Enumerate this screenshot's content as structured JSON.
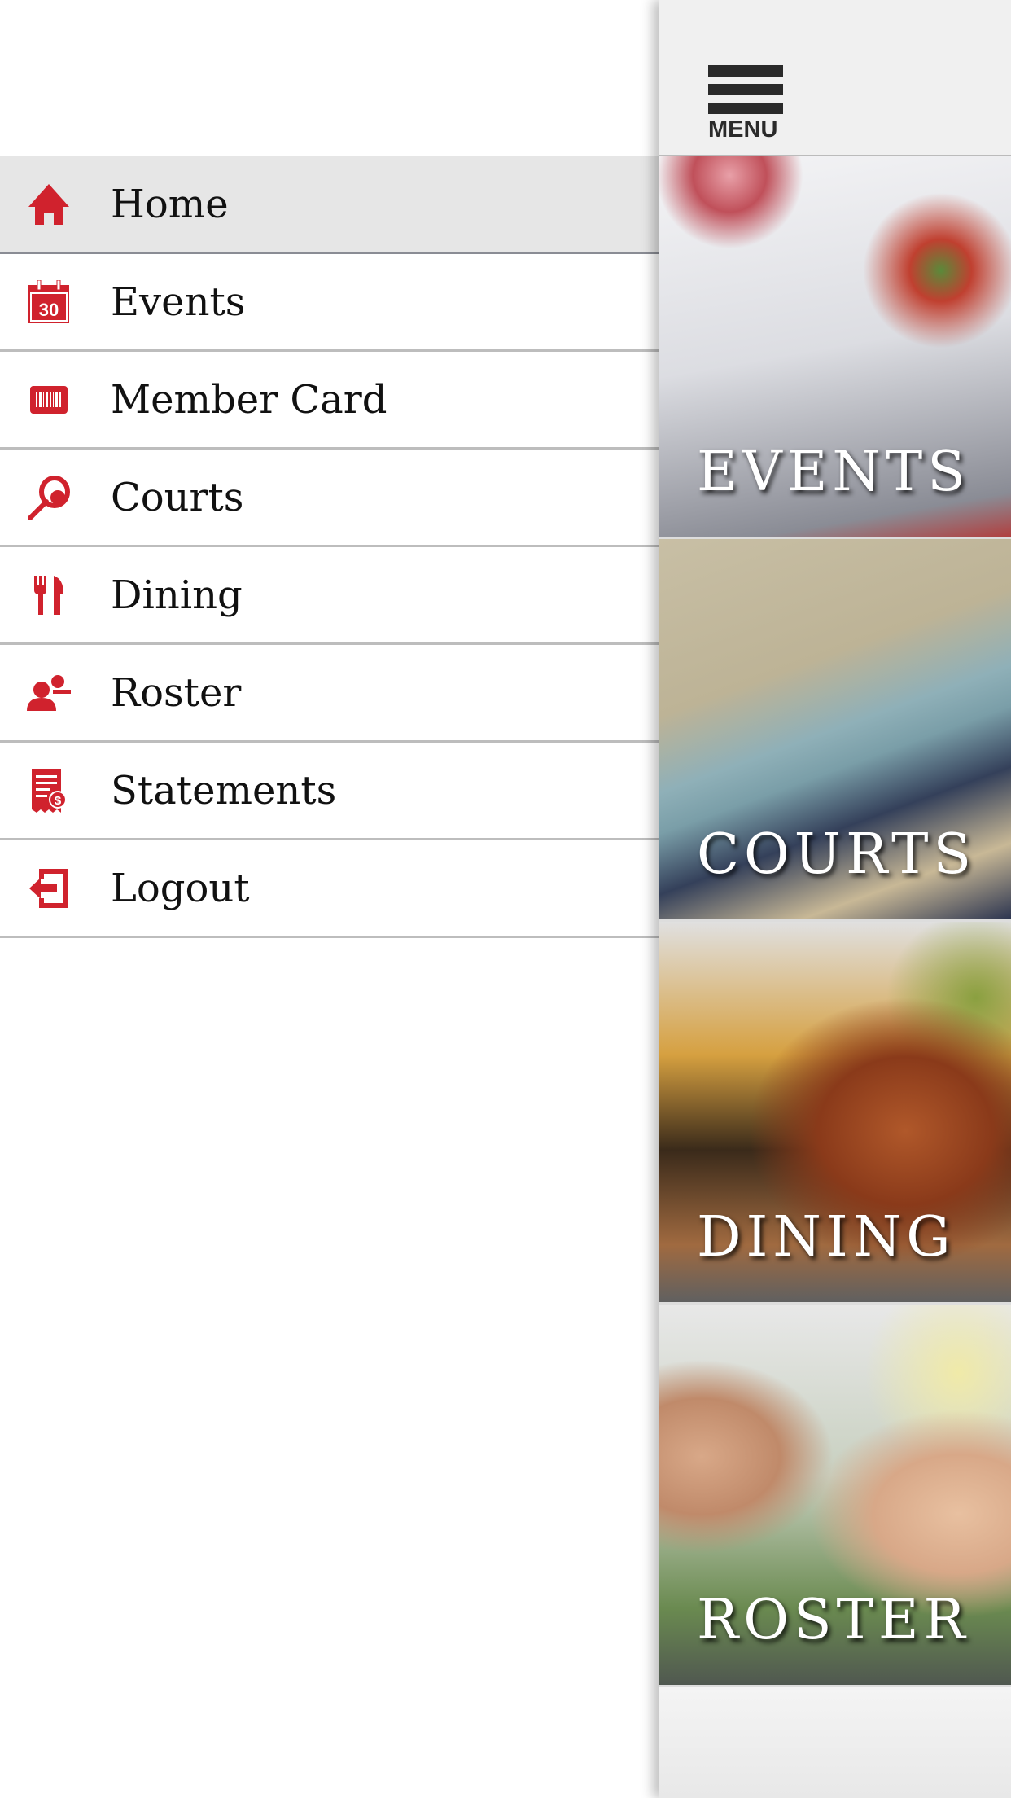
{
  "drawer": {
    "accent": "#d0222d",
    "items": [
      {
        "label": "Home",
        "icon": "home-icon",
        "active": true
      },
      {
        "label": "Events",
        "icon": "calendar-icon",
        "icon_text": "30"
      },
      {
        "label": "Member Card",
        "icon": "barcode-card-icon"
      },
      {
        "label": "Courts",
        "icon": "tennis-racket-icon"
      },
      {
        "label": "Dining",
        "icon": "fork-knife-icon"
      },
      {
        "label": "Roster",
        "icon": "people-icon"
      },
      {
        "label": "Statements",
        "icon": "statement-icon"
      },
      {
        "label": "Logout",
        "icon": "logout-icon"
      }
    ]
  },
  "main": {
    "menu_label": "MENU",
    "tiles": [
      {
        "label": "EVENTS"
      },
      {
        "label": "COURTS"
      },
      {
        "label": "DINING"
      },
      {
        "label": "ROSTER"
      }
    ]
  }
}
